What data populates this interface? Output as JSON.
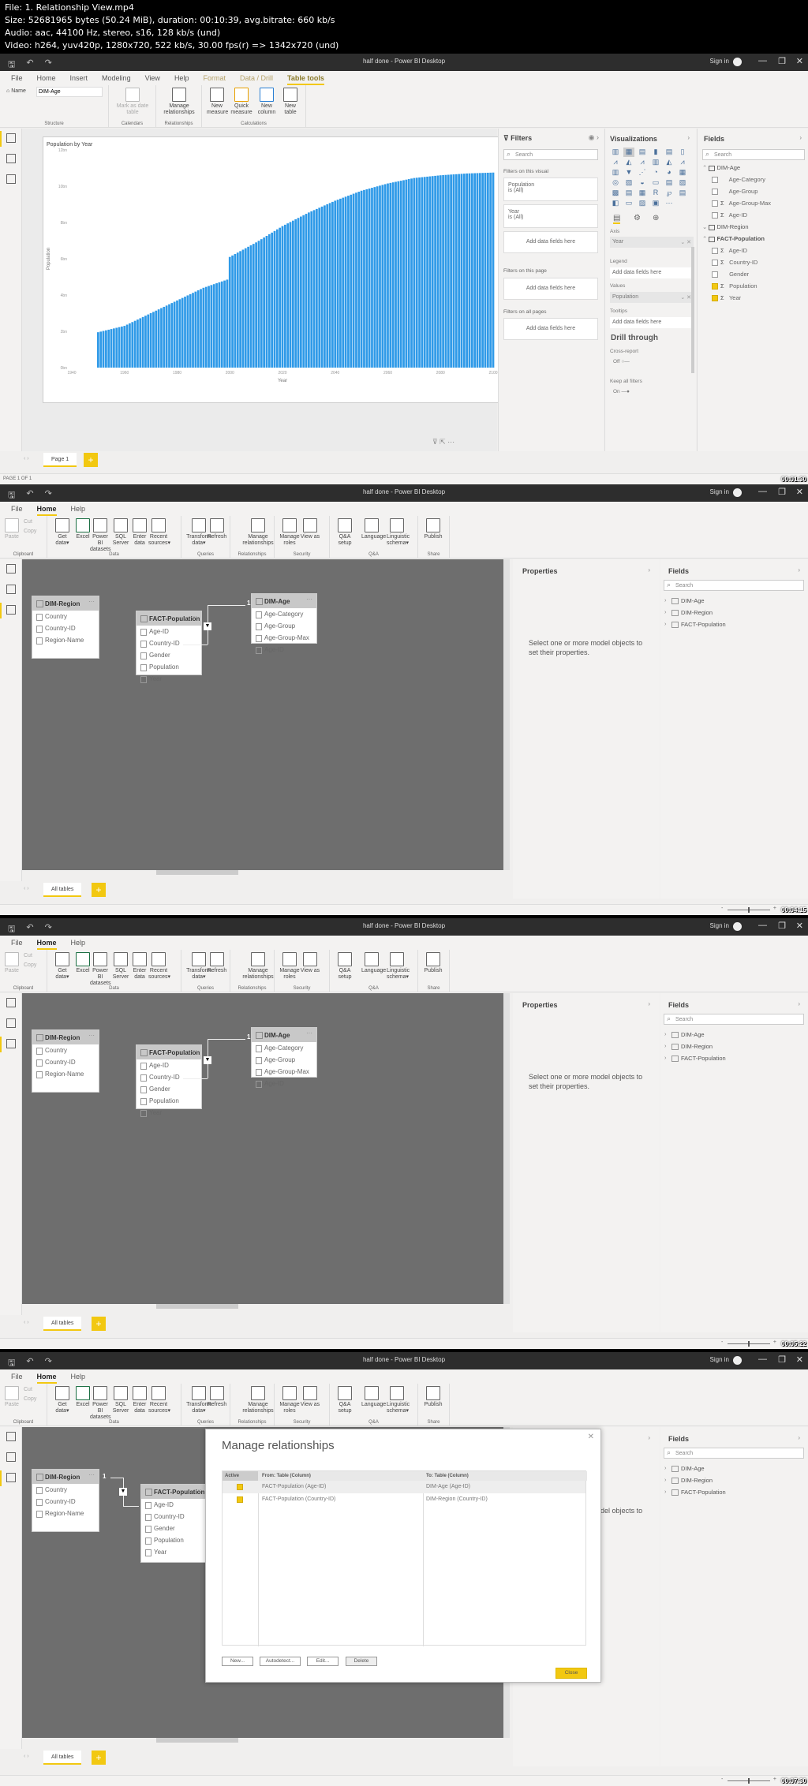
{
  "header": {
    "line1": "File: 1. Relationship View.mp4",
    "line2": "Size: 52681965 bytes (50.24 MiB), duration: 00:10:39, avg.bitrate: 660 kb/s",
    "line3": "Audio: aac, 44100 Hz, stereo, s16, 128 kb/s (und)",
    "line4": "Video: h264, yuv420p, 1280x720, 522 kb/s, 30.00 fps(r) => 1342x720 (und)"
  },
  "window": {
    "title": "half done - Power BI Desktop",
    "sign_in": "Sign in",
    "minimize": "—",
    "restore": "❐",
    "close": "✕"
  },
  "frames": [
    {
      "timestamp": "00:01:30",
      "menu": [
        "File",
        "Home",
        "Insert",
        "Modeling",
        "View",
        "Help",
        "Format",
        "Data / Drill",
        "Table tools"
      ],
      "ribbon": {
        "name_label": "Name",
        "name_value": "DIM-Age",
        "mark_date": "Mark as date table",
        "manage_rel": "Manage relationships",
        "new_measure": "New measure",
        "quick_measure": "Quick measure",
        "new_column": "New column",
        "new_table": "New table",
        "groups": [
          "Structure",
          "Calendars",
          "Relationships",
          "Calculations"
        ]
      },
      "filters": {
        "title": "Filters",
        "search": "Search",
        "on_visual": "Filters on this visual",
        "f1_name": "Population",
        "f1_val": "is (All)",
        "f2_name": "Year",
        "f2_val": "is (All)",
        "add": "Add data fields here",
        "on_page": "Filters on this page",
        "on_all": "Filters on all pages"
      },
      "viz": {
        "title": "Visualizations",
        "axis": "Axis",
        "axis_val": "Year",
        "legend": "Legend",
        "values": "Values",
        "values_val": "Population",
        "tooltips": "Tooltips",
        "add": "Add data fields here",
        "drill": "Drill through",
        "cross": "Cross-report",
        "off": "Off",
        "keep": "Keep all filters",
        "on": "On"
      },
      "fields": {
        "title": "Fields",
        "search": "Search",
        "tables": [
          {
            "name": "DIM-Age",
            "items": [
              {
                "label": "Age-Category",
                "sigma": false,
                "checked": false
              },
              {
                "label": "Age-Group",
                "sigma": false,
                "checked": false
              },
              {
                "label": "Age-Group-Max",
                "sigma": true,
                "checked": false
              },
              {
                "label": "Age-ID",
                "sigma": true,
                "checked": false
              }
            ]
          },
          {
            "name": "DIM-Region",
            "items": []
          },
          {
            "name": "FACT-Population",
            "items": [
              {
                "label": "Age-ID",
                "sigma": true,
                "checked": false
              },
              {
                "label": "Country-ID",
                "sigma": true,
                "checked": false
              },
              {
                "label": "Gender",
                "sigma": false,
                "checked": false
              },
              {
                "label": "Population",
                "sigma": true,
                "checked": true
              },
              {
                "label": "Year",
                "sigma": true,
                "checked": true
              }
            ]
          }
        ]
      },
      "page_tab": "Page 1",
      "status": "PAGE 1 OF 1"
    },
    {
      "timestamp": "00:04:15",
      "view": "model"
    },
    {
      "timestamp": "00:05:22",
      "view": "model"
    },
    {
      "timestamp": "00:07:30",
      "view": "model-dialog"
    }
  ],
  "home_ribbon": {
    "menu": [
      "File",
      "Home",
      "Help"
    ],
    "paste": "Paste",
    "cut": "Cut",
    "copy": "Copy",
    "buttons": [
      {
        "label": "Get data",
        "sub": "▾"
      },
      {
        "label": "Excel"
      },
      {
        "label": "Power BI datasets"
      },
      {
        "label": "SQL Server"
      },
      {
        "label": "Enter data"
      },
      {
        "label": "Recent sources",
        "sub": "▾"
      },
      {
        "label": "Transform data",
        "sub": "▾"
      },
      {
        "label": "Refresh"
      },
      {
        "label": "Manage relationships"
      },
      {
        "label": "Manage roles"
      },
      {
        "label": "View as"
      },
      {
        "label": "Q&A setup"
      },
      {
        "label": "Language"
      },
      {
        "label": "Linguistic schema",
        "sub": "▾"
      },
      {
        "label": "Publish"
      }
    ],
    "groups": [
      "Clipboard",
      "Data",
      "Queries",
      "Relationships",
      "Security",
      "Q&A",
      "Share"
    ]
  },
  "model": {
    "tables": [
      {
        "name": "DIM-Region",
        "fields": [
          "Country",
          "Country-ID",
          "Region-Name"
        ]
      },
      {
        "name": "FACT-Population",
        "fields": [
          "Age-ID",
          "Country-ID",
          "Gender",
          "Population",
          "Year"
        ]
      },
      {
        "name": "DIM-Age",
        "fields": [
          "Age-Category",
          "Age-Group",
          "Age-Group-Max",
          "Age-ID"
        ]
      }
    ],
    "one": "1",
    "many": "*",
    "properties_title": "Properties",
    "properties_msg": "Select one or more model objects to set their properties.",
    "fields_title": "Fields",
    "search": "Search",
    "field_tables": [
      "DIM-Age",
      "DIM-Region",
      "FACT-Population"
    ],
    "tab": "All tables"
  },
  "dialog": {
    "title": "Manage relationships",
    "columns": [
      "Active",
      "From: Table (Column)",
      "To: Table (Column)"
    ],
    "rows": [
      {
        "active": true,
        "from": "FACT-Population (Age-ID)",
        "to": "DIM-Age (Age-ID)"
      },
      {
        "active": true,
        "from": "FACT-Population (Country-ID)",
        "to": "DIM-Region (Country-ID)"
      }
    ],
    "buttons": [
      "New...",
      "Autodetect...",
      "Edit...",
      "Delete"
    ],
    "close": "Close"
  },
  "colors": {
    "accent": "#f2c811",
    "bar": "#2f9ae8",
    "canvas": "#6e6e6e"
  },
  "chart_data": {
    "type": "bar",
    "title": "Population by Year",
    "xlabel": "Year",
    "ylabel": "Population",
    "xlim": [
      1940,
      2100
    ],
    "ylim": [
      0,
      12000000000
    ],
    "x_ticks": [
      "1940",
      "1960",
      "1980",
      "2000",
      "2020",
      "2040",
      "2060",
      "2080",
      "2100"
    ],
    "y_ticks": [
      "0bn",
      "2bn",
      "4bn",
      "6bn",
      "8bn",
      "10bn",
      "12bn"
    ],
    "x": [
      1950,
      1960,
      1970,
      1980,
      1990,
      1999,
      2000,
      2010,
      2020,
      2030,
      2040,
      2050,
      2060,
      2070,
      2080,
      2090,
      2100
    ],
    "values": [
      1950000000.0,
      2300000000.0,
      3000000000.0,
      3700000000.0,
      4400000000.0,
      4850000000.0,
      6100000000.0,
      6900000000.0,
      7800000000.0,
      8550000000.0,
      9200000000.0,
      9750000000.0,
      10150000000.0,
      10450000000.0,
      10600000000.0,
      10700000000.0,
      10750000000.0
    ]
  }
}
